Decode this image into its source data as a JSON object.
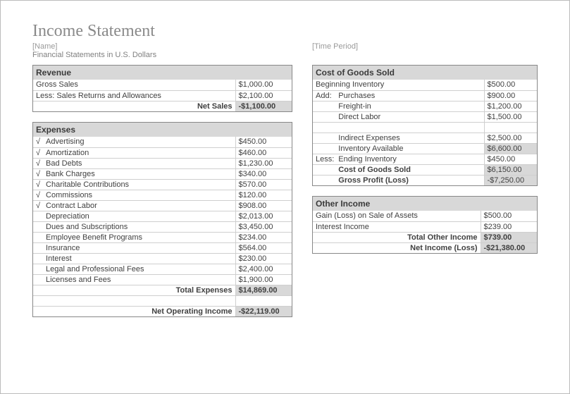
{
  "title": "Income Statement",
  "name_placeholder": "[Name]",
  "time_period_placeholder": "[Time Period]",
  "subheader": "Financial Statements in U.S. Dollars",
  "revenue": {
    "header": "Revenue",
    "gross_sales_label": "Gross Sales",
    "gross_sales_value": "$1,000.00",
    "returns_label": "Less: Sales Returns and Allowances",
    "returns_value": "$2,100.00",
    "net_sales_label": "Net Sales",
    "net_sales_value": "-$1,100.00"
  },
  "expenses": {
    "header": "Expenses",
    "items": [
      {
        "mark": "√",
        "label": "Advertising",
        "value": "$450.00"
      },
      {
        "mark": "√",
        "label": "Amortization",
        "value": "$460.00"
      },
      {
        "mark": "√",
        "label": "Bad Debts",
        "value": "$1,230.00"
      },
      {
        "mark": "√",
        "label": "Bank Charges",
        "value": "$340.00"
      },
      {
        "mark": "√",
        "label": "Charitable Contributions",
        "value": "$570.00"
      },
      {
        "mark": "√",
        "label": "Commissions",
        "value": "$120.00"
      },
      {
        "mark": "√",
        "label": "Contract Labor",
        "value": "$908.00"
      },
      {
        "mark": "",
        "label": "Depreciation",
        "value": "$2,013.00"
      },
      {
        "mark": "",
        "label": "Dues and Subscriptions",
        "value": "$3,450.00"
      },
      {
        "mark": "",
        "label": "Employee Benefit Programs",
        "value": "$234.00"
      },
      {
        "mark": "",
        "label": "Insurance",
        "value": "$564.00"
      },
      {
        "mark": "",
        "label": "Interest",
        "value": "$230.00"
      },
      {
        "mark": "",
        "label": "Legal and Professional Fees",
        "value": "$2,400.00"
      },
      {
        "mark": "",
        "label": "Licenses and Fees",
        "value": "$1,900.00"
      }
    ],
    "total_label": "Total Expenses",
    "total_value": "$14,869.00",
    "net_op_label": "Net Operating Income",
    "net_op_value": "-$22,119.00"
  },
  "cogs": {
    "header": "Cost of Goods Sold",
    "rows": {
      "begin_inv_label": "Beginning Inventory",
      "begin_inv_value": "$500.00",
      "add_label": "Add:",
      "purchases_label": "Purchases",
      "purchases_value": "$900.00",
      "freight_label": "Freight-in",
      "freight_value": "$1,200.00",
      "direct_labor_label": "Direct Labor",
      "direct_labor_value": "$1,500.00",
      "indirect_label": "Indirect Expenses",
      "indirect_value": "$2,500.00",
      "inv_avail_label": "Inventory Available",
      "inv_avail_value": "$6,600.00",
      "less_label": "Less:",
      "end_inv_label": "Ending Inventory",
      "end_inv_value": "$450.00",
      "cogs_label": "Cost of Goods Sold",
      "cogs_value": "$6,150.00",
      "gross_profit_label": "Gross Profit (Loss)",
      "gross_profit_value": "-$7,250.00"
    }
  },
  "other_income": {
    "header": "Other Income",
    "gain_label": "Gain (Loss) on Sale of Assets",
    "gain_value": "$500.00",
    "interest_label": "Interest Income",
    "interest_value": "$239.00",
    "total_label": "Total Other Income",
    "total_value": "$739.00",
    "net_income_label": "Net Income (Loss)",
    "net_income_value": "-$21,380.00"
  }
}
